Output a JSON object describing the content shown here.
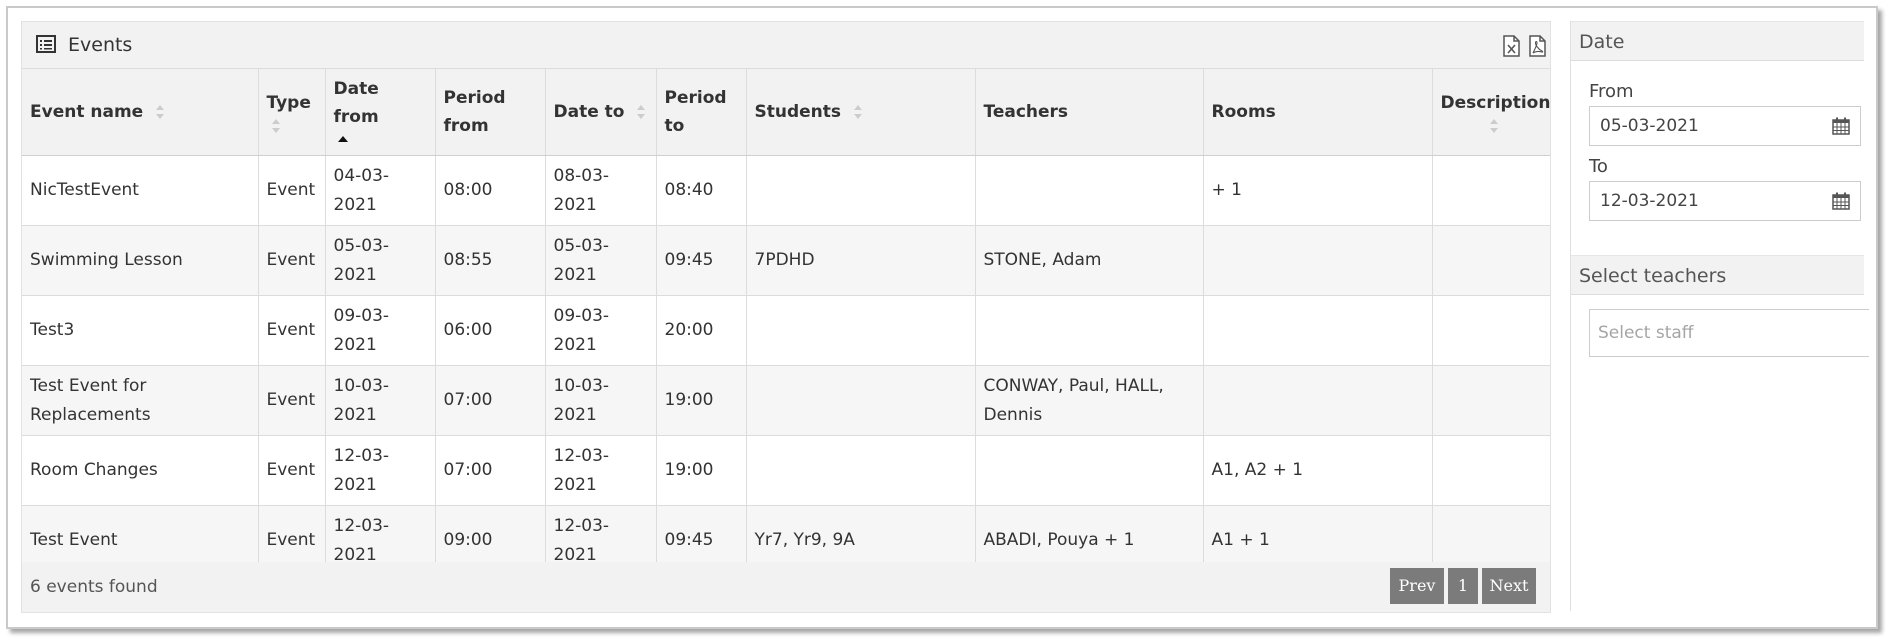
{
  "events": {
    "title": "Events",
    "columns": [
      {
        "label": "Event name",
        "sort": "none"
      },
      {
        "label": "Type",
        "sort": "none"
      },
      {
        "label": "Date from",
        "sort": "asc"
      },
      {
        "label": "Period from",
        "sort": null
      },
      {
        "label": "Date to",
        "sort": "none"
      },
      {
        "label": "Period to",
        "sort": null
      },
      {
        "label": "Students",
        "sort": "none"
      },
      {
        "label": "Teachers",
        "sort": null
      },
      {
        "label": "Rooms",
        "sort": null
      },
      {
        "label": "Description",
        "sort": "none"
      }
    ],
    "rows": [
      {
        "name": "NicTestEvent",
        "type": "Event",
        "date_from": "04-03-2021",
        "period_from": "08:00",
        "date_to": "08-03-2021",
        "period_to": "08:40",
        "students": "",
        "teachers": "",
        "rooms": "+ 1",
        "description": ""
      },
      {
        "name": "Swimming Lesson",
        "type": "Event",
        "date_from": "05-03-2021",
        "period_from": "08:55",
        "date_to": "05-03-2021",
        "period_to": "09:45",
        "students": "7PDHD",
        "teachers": "STONE, Adam",
        "rooms": "",
        "description": ""
      },
      {
        "name": "Test3",
        "type": "Event",
        "date_from": "09-03-2021",
        "period_from": "06:00",
        "date_to": "09-03-2021",
        "period_to": "20:00",
        "students": "",
        "teachers": "",
        "rooms": "",
        "description": ""
      },
      {
        "name": "Test Event for Replacements",
        "type": "Event",
        "date_from": "10-03-2021",
        "period_from": "07:00",
        "date_to": "10-03-2021",
        "period_to": "19:00",
        "students": "",
        "teachers": "CONWAY, Paul, HALL, Dennis",
        "rooms": "",
        "description": ""
      },
      {
        "name": "Room Changes",
        "type": "Event",
        "date_from": "12-03-2021",
        "period_from": "07:00",
        "date_to": "12-03-2021",
        "period_to": "19:00",
        "students": "",
        "teachers": "",
        "rooms": "A1, A2 + 1",
        "description": ""
      },
      {
        "name": "Test Event",
        "type": "Event",
        "date_from": "12-03-2021",
        "period_from": "09:00",
        "date_to": "12-03-2021",
        "period_to": "09:45",
        "students": "Yr7, Yr9, 9A",
        "teachers": "ABADI, Pouya + 1",
        "rooms": "A1 + 1",
        "description": ""
      }
    ],
    "count_text": "6 events found",
    "pager": {
      "prev": "Prev",
      "page": "1",
      "next": "Next"
    },
    "icons": {
      "title": "list-icon",
      "excel": "excel-export-icon",
      "pdf": "pdf-export-icon"
    }
  },
  "filters": {
    "date": {
      "header": "Date",
      "from_label": "From",
      "from_value": "05-03-2021",
      "to_label": "To",
      "to_value": "12-03-2021"
    },
    "teachers": {
      "header": "Select teachers",
      "placeholder": "Select staff"
    }
  },
  "colors": {
    "header_bg": "#f2f2f2",
    "stripe_bg": "#f6f6f6",
    "pager_bg": "#7b7b7b",
    "border": "#dcdcdc"
  }
}
